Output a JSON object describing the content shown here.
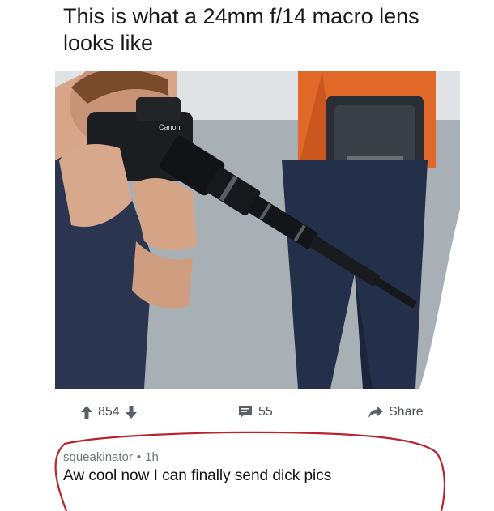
{
  "post": {
    "title_line1": "This is what a 24mm f/14 macro lens",
    "title_line2": "looks like"
  },
  "image": {
    "description_icon": "photo-camera-long-lens",
    "brand_text": "Canon"
  },
  "actions": {
    "upvotes": "854",
    "comments": "55",
    "share_label": "Share"
  },
  "comment": {
    "username": "squeakinator",
    "separator": "•",
    "time": "1h",
    "text": "Aw cool now I can finally send dick pics"
  },
  "colors": {
    "annotation_circle": "#b8232e",
    "text_muted": "#6e7378"
  }
}
